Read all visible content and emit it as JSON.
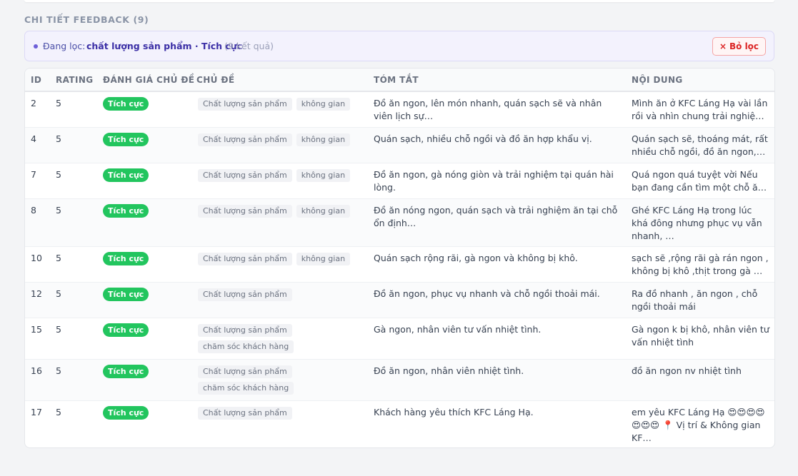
{
  "section": {
    "title": "CHI TIẾT FEEDBACK (9)"
  },
  "filter": {
    "label": "Đang lọc:",
    "value": "chất lượng sản phẩm · Tích cực",
    "count": "(9 kết quả)",
    "clear_icon": "×",
    "clear_label": "Bỏ lọc"
  },
  "table": {
    "columns": [
      "ID",
      "RATING",
      "ĐÁNH GIÁ CHỦ ĐỀ",
      "CHỦ ĐỀ",
      "TÓM TẮT",
      "NỘI DUNG"
    ],
    "rows": [
      {
        "id": "2",
        "rating": "5",
        "sentiment": "Tích cực",
        "tags": [
          "Chất lượng sản phẩm",
          "không gian"
        ],
        "summary": "Đồ ăn ngon, lên món nhanh, quán sạch sẽ và nhân viên lịch sự…",
        "content": "Mình ăn ở KFC Láng Hạ vài lần rồi và nhìn chung trải nghiệm …"
      },
      {
        "id": "4",
        "rating": "5",
        "sentiment": "Tích cực",
        "tags": [
          "Chất lượng sản phẩm",
          "không gian"
        ],
        "summary": "Quán sạch, nhiều chỗ ngồi và đồ ăn hợp khẩu vị.",
        "content": "Quán sạch sẽ, thoáng mát, rất nhiều chỗ ngồi, đồ ăn ngon, gà…"
      },
      {
        "id": "7",
        "rating": "5",
        "sentiment": "Tích cực",
        "tags": [
          "Chất lượng sản phẩm",
          "không gian"
        ],
        "summary": "Đồ ăn ngon, gà nóng giòn và trải nghiệm tại quán hài lòng.",
        "content": "Quá ngon quá tuyệt vời Nếu bạn đang cần tìm một chỗ ăn gà rá…"
      },
      {
        "id": "8",
        "rating": "5",
        "sentiment": "Tích cực",
        "tags": [
          "Chất lượng sản phẩm",
          "không gian"
        ],
        "summary": "Đồ ăn nóng ngon, quán sạch và trải nghiệm ăn tại chỗ ổn định…",
        "content": "Ghé KFC Láng Hạ trong lúc khá đông nhưng phục vụ vẫn nhanh, …"
      },
      {
        "id": "10",
        "rating": "5",
        "sentiment": "Tích cực",
        "tags": [
          "Chất lượng sản phẩm",
          "không gian"
        ],
        "summary": "Quán sạch rộng rãi, gà ngon và không bị khô.",
        "content": "sạch sẽ ,rộng rãi gà rán ngon , không bị khô ,thịt trong gà …"
      },
      {
        "id": "12",
        "rating": "5",
        "sentiment": "Tích cực",
        "tags": [
          "Chất lượng sản phẩm"
        ],
        "summary": "Đồ ăn ngon, phục vụ nhanh và chỗ ngồi thoải mái.",
        "content": "Ra đồ nhanh , ăn ngon , chỗ ngồi thoải mái"
      },
      {
        "id": "15",
        "rating": "5",
        "sentiment": "Tích cực",
        "tags": [
          "Chất lượng sản phẩm",
          "chăm sóc khách hàng"
        ],
        "summary": "Gà ngon, nhân viên tư vấn nhiệt tình.",
        "content": "Gà ngon k bị khô, nhân viên tư vấn nhiệt tình"
      },
      {
        "id": "16",
        "rating": "5",
        "sentiment": "Tích cực",
        "tags": [
          "Chất lượng sản phẩm",
          "chăm sóc khách hàng"
        ],
        "summary": "Đồ ăn ngon, nhân viên nhiệt tình.",
        "content": "đồ ăn ngon nv nhiệt tình"
      },
      {
        "id": "17",
        "rating": "5",
        "sentiment": "Tích cực",
        "tags": [
          "Chất lượng sản phẩm"
        ],
        "summary": "Khách hàng yêu thích KFC Láng Hạ.",
        "content": "em yêu KFC Láng Hạ 😍😍😍😍 😍😍😍 📍 Vị trí & Không gian KF…"
      }
    ]
  },
  "colors": {
    "badge_positive": "#22c55e",
    "filter_accent": "#3b2fa6",
    "clear_button": "#dc2626"
  }
}
